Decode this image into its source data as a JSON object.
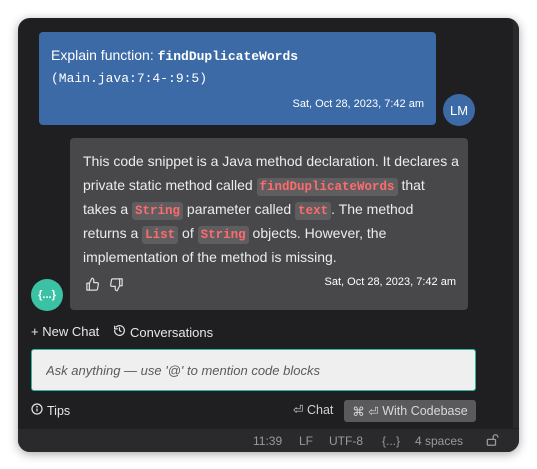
{
  "user_message": {
    "prefix": "Explain function: ",
    "function_name": "findDuplicateWords",
    "location": "(Main.java:7:4-:9:5)",
    "timestamp": "Sat, Oct 28, 2023, 7:42 am",
    "avatar_initials": "LM"
  },
  "assistant_message": {
    "t1": "This code snippet is a Java method declaration. It declares a private static method called ",
    "c1": "findDuplicateWords",
    "t2": " that takes a ",
    "c2": "String",
    "t3": " parameter called ",
    "c3": "text",
    "t4": ". The method returns a ",
    "c4": "List",
    "t5": " of ",
    "c5": "String",
    "t6": " objects. However, the implementation of the method is missing.",
    "timestamp": "Sat, Oct 28, 2023, 7:42 am",
    "avatar_label": "{...}"
  },
  "controls": {
    "new_chat": "+ New Chat",
    "conversations": "Conversations",
    "input_placeholder": "Ask anything — use '@' to mention code blocks",
    "tips": "Tips",
    "chat": "Chat",
    "codebase": "With Codebase"
  },
  "status_bar": {
    "position": "11:39",
    "line_ending": "LF",
    "encoding": "UTF-8",
    "context": "{...}",
    "indent": "4 spaces"
  },
  "colors": {
    "user_bubble": "#3b6aa6",
    "assistant_bubble": "#48484a",
    "code_highlight": "#ff6b6b",
    "accent": "#2fb5a0"
  }
}
